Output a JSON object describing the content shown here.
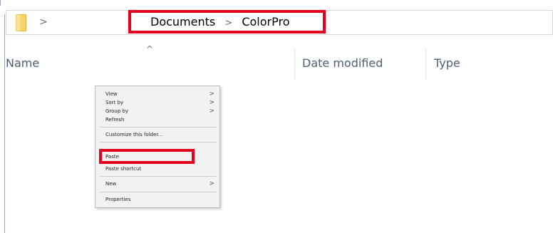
{
  "address_bar": {
    "folder_icon": "folder-icon",
    "chevron": ">",
    "path": [
      "Documents",
      "ColorPro"
    ],
    "separator": ">"
  },
  "columns": {
    "sort_indicator": "^",
    "name": "Name",
    "date_modified": "Date modified",
    "type": "Type"
  },
  "context_menu": {
    "items": [
      {
        "label": "View",
        "submenu": true
      },
      {
        "label": "Sort by",
        "submenu": true
      },
      {
        "label": "Group by",
        "submenu": true
      },
      {
        "label": "Refresh",
        "submenu": false
      },
      {
        "label": "Customize this folder...",
        "submenu": false
      },
      {
        "label": "Paste",
        "submenu": false
      },
      {
        "label": "Paste shortcut",
        "submenu": false
      },
      {
        "label": "New",
        "submenu": true
      },
      {
        "label": "Properties",
        "submenu": false
      }
    ],
    "submenu_arrow": ">"
  },
  "colors": {
    "highlight": "#e6001f",
    "header_text": "#4c607a",
    "folder_yellow": "#f5d36b"
  }
}
